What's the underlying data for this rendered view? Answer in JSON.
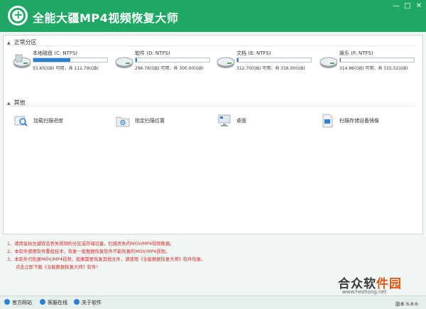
{
  "window": {
    "title": "全能大疆MP4视频恢复大师",
    "controls": {
      "min": "—",
      "max": "□",
      "close": "✕"
    }
  },
  "sections": {
    "partitions": "正常分区",
    "others": "其他"
  },
  "drives": [
    {
      "name": "本地磁盘 (C: NTFS)",
      "size": "55.65(GB) 可用，共 111.79(GB)",
      "used_fraction": 0.5
    },
    {
      "name": "软件 (D: NTFS)",
      "size": "296.76(GB) 可用，共 300.00(GB)",
      "used_fraction": 0.02
    },
    {
      "name": "文档 (E: NTFS)",
      "size": "312.70(GB) 可用，共 316.00(GB)",
      "used_fraction": 0.02
    },
    {
      "name": "娱乐 (F: NTFS)",
      "size": "314.86(GB) 可用，共 315.51(GB)",
      "used_fraction": 0.01
    }
  ],
  "actions": [
    {
      "label": "加载扫描进度",
      "icon": "magnifier-load-icon"
    },
    {
      "label": "指定扫描位置",
      "icon": "folder-target-icon"
    },
    {
      "label": "桌面",
      "icon": "desktop-icon"
    },
    {
      "label": "扫描存储设备镜像",
      "icon": "disk-image-icon"
    }
  ],
  "notes": [
    "1、请用鼠标左键双击丢失视频的分区或存储设备，扫描丢失的MOV/MP4视频数据。",
    "2、本软件使用软件重组技术，恢复一般数据恢复软件不能恢复的MOV/MP4视频。",
    "3、本软件只恢复MOV/MP4视频，如果需要恢复其他文件，请使用《全能数据恢复大师》软件恢复。",
    "点击立即下载《全能数据恢复大师》软件！"
  ],
  "footer": {
    "links": [
      "官方网站",
      "客服在线",
      "关于软件"
    ],
    "version": "版本 6.8.6"
  },
  "watermark": {
    "text_a": "合众软",
    "text_b": "件园",
    "url": "www.hezhong.net"
  },
  "colors": {
    "brand": "#1fa764",
    "bar_fill": "#2e7fd6",
    "note_red": "#d62b2b"
  }
}
